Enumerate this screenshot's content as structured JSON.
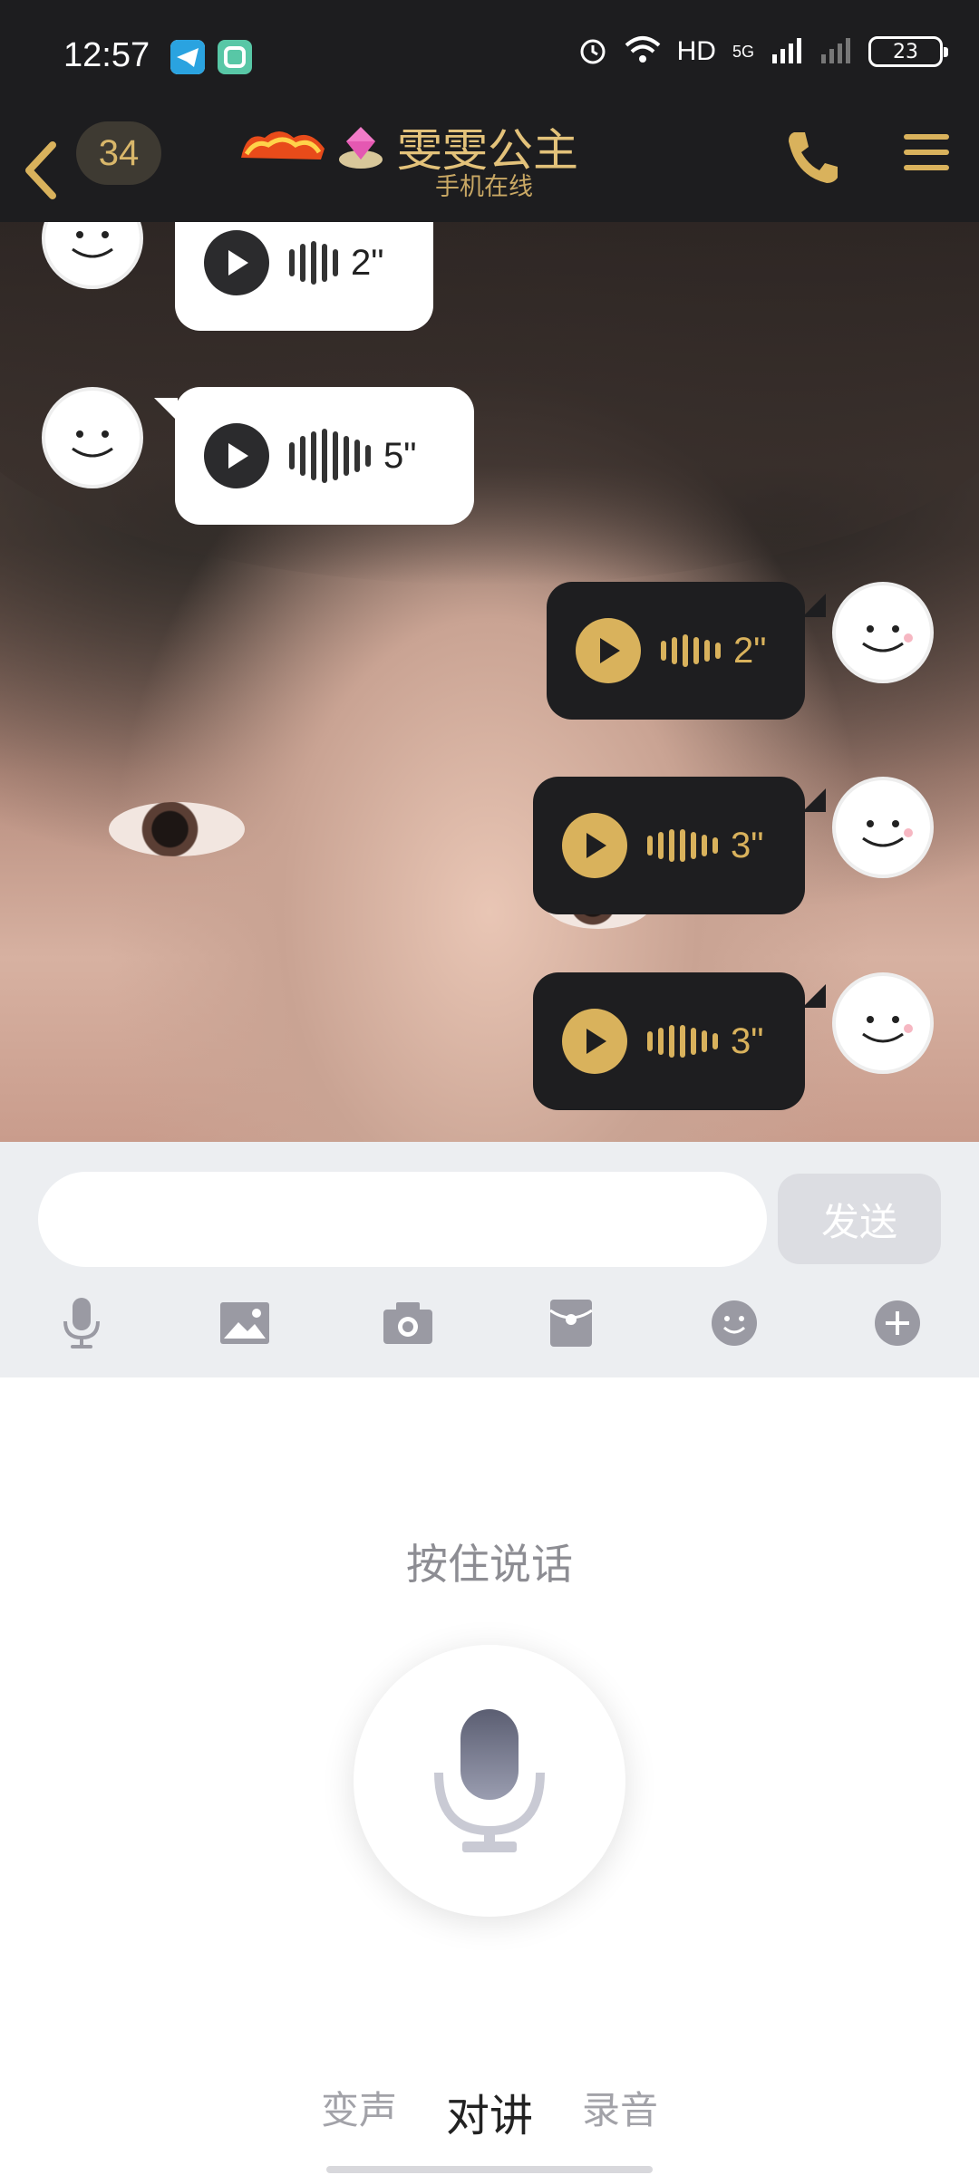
{
  "status_bar": {
    "time": "12:57",
    "network": "HD",
    "network_gen": "5G",
    "battery": "23"
  },
  "header": {
    "unread_count": "34",
    "contact_name": "雯雯公主",
    "contact_status": "手机在线"
  },
  "messages": [
    {
      "side": "left",
      "duration": "2\""
    },
    {
      "side": "left",
      "duration": "5\""
    },
    {
      "side": "right",
      "duration": "2\""
    },
    {
      "side": "right",
      "duration": "3\""
    },
    {
      "side": "right",
      "duration": "3\""
    }
  ],
  "input": {
    "value": "",
    "send_label": "发送"
  },
  "toolbar": [
    "mic-icon",
    "image-icon",
    "camera-icon",
    "red-packet-icon",
    "emoji-icon",
    "plus-icon"
  ],
  "voice_panel": {
    "hint": "按住说话",
    "modes": [
      "变声",
      "对讲",
      "录音"
    ],
    "active_mode": "对讲"
  },
  "colors": {
    "accent_gold": "#d9b25c",
    "header_bg": "#1d1d1f",
    "bubble_self": "#1e1e20",
    "bubble_other": "#ffffff"
  }
}
